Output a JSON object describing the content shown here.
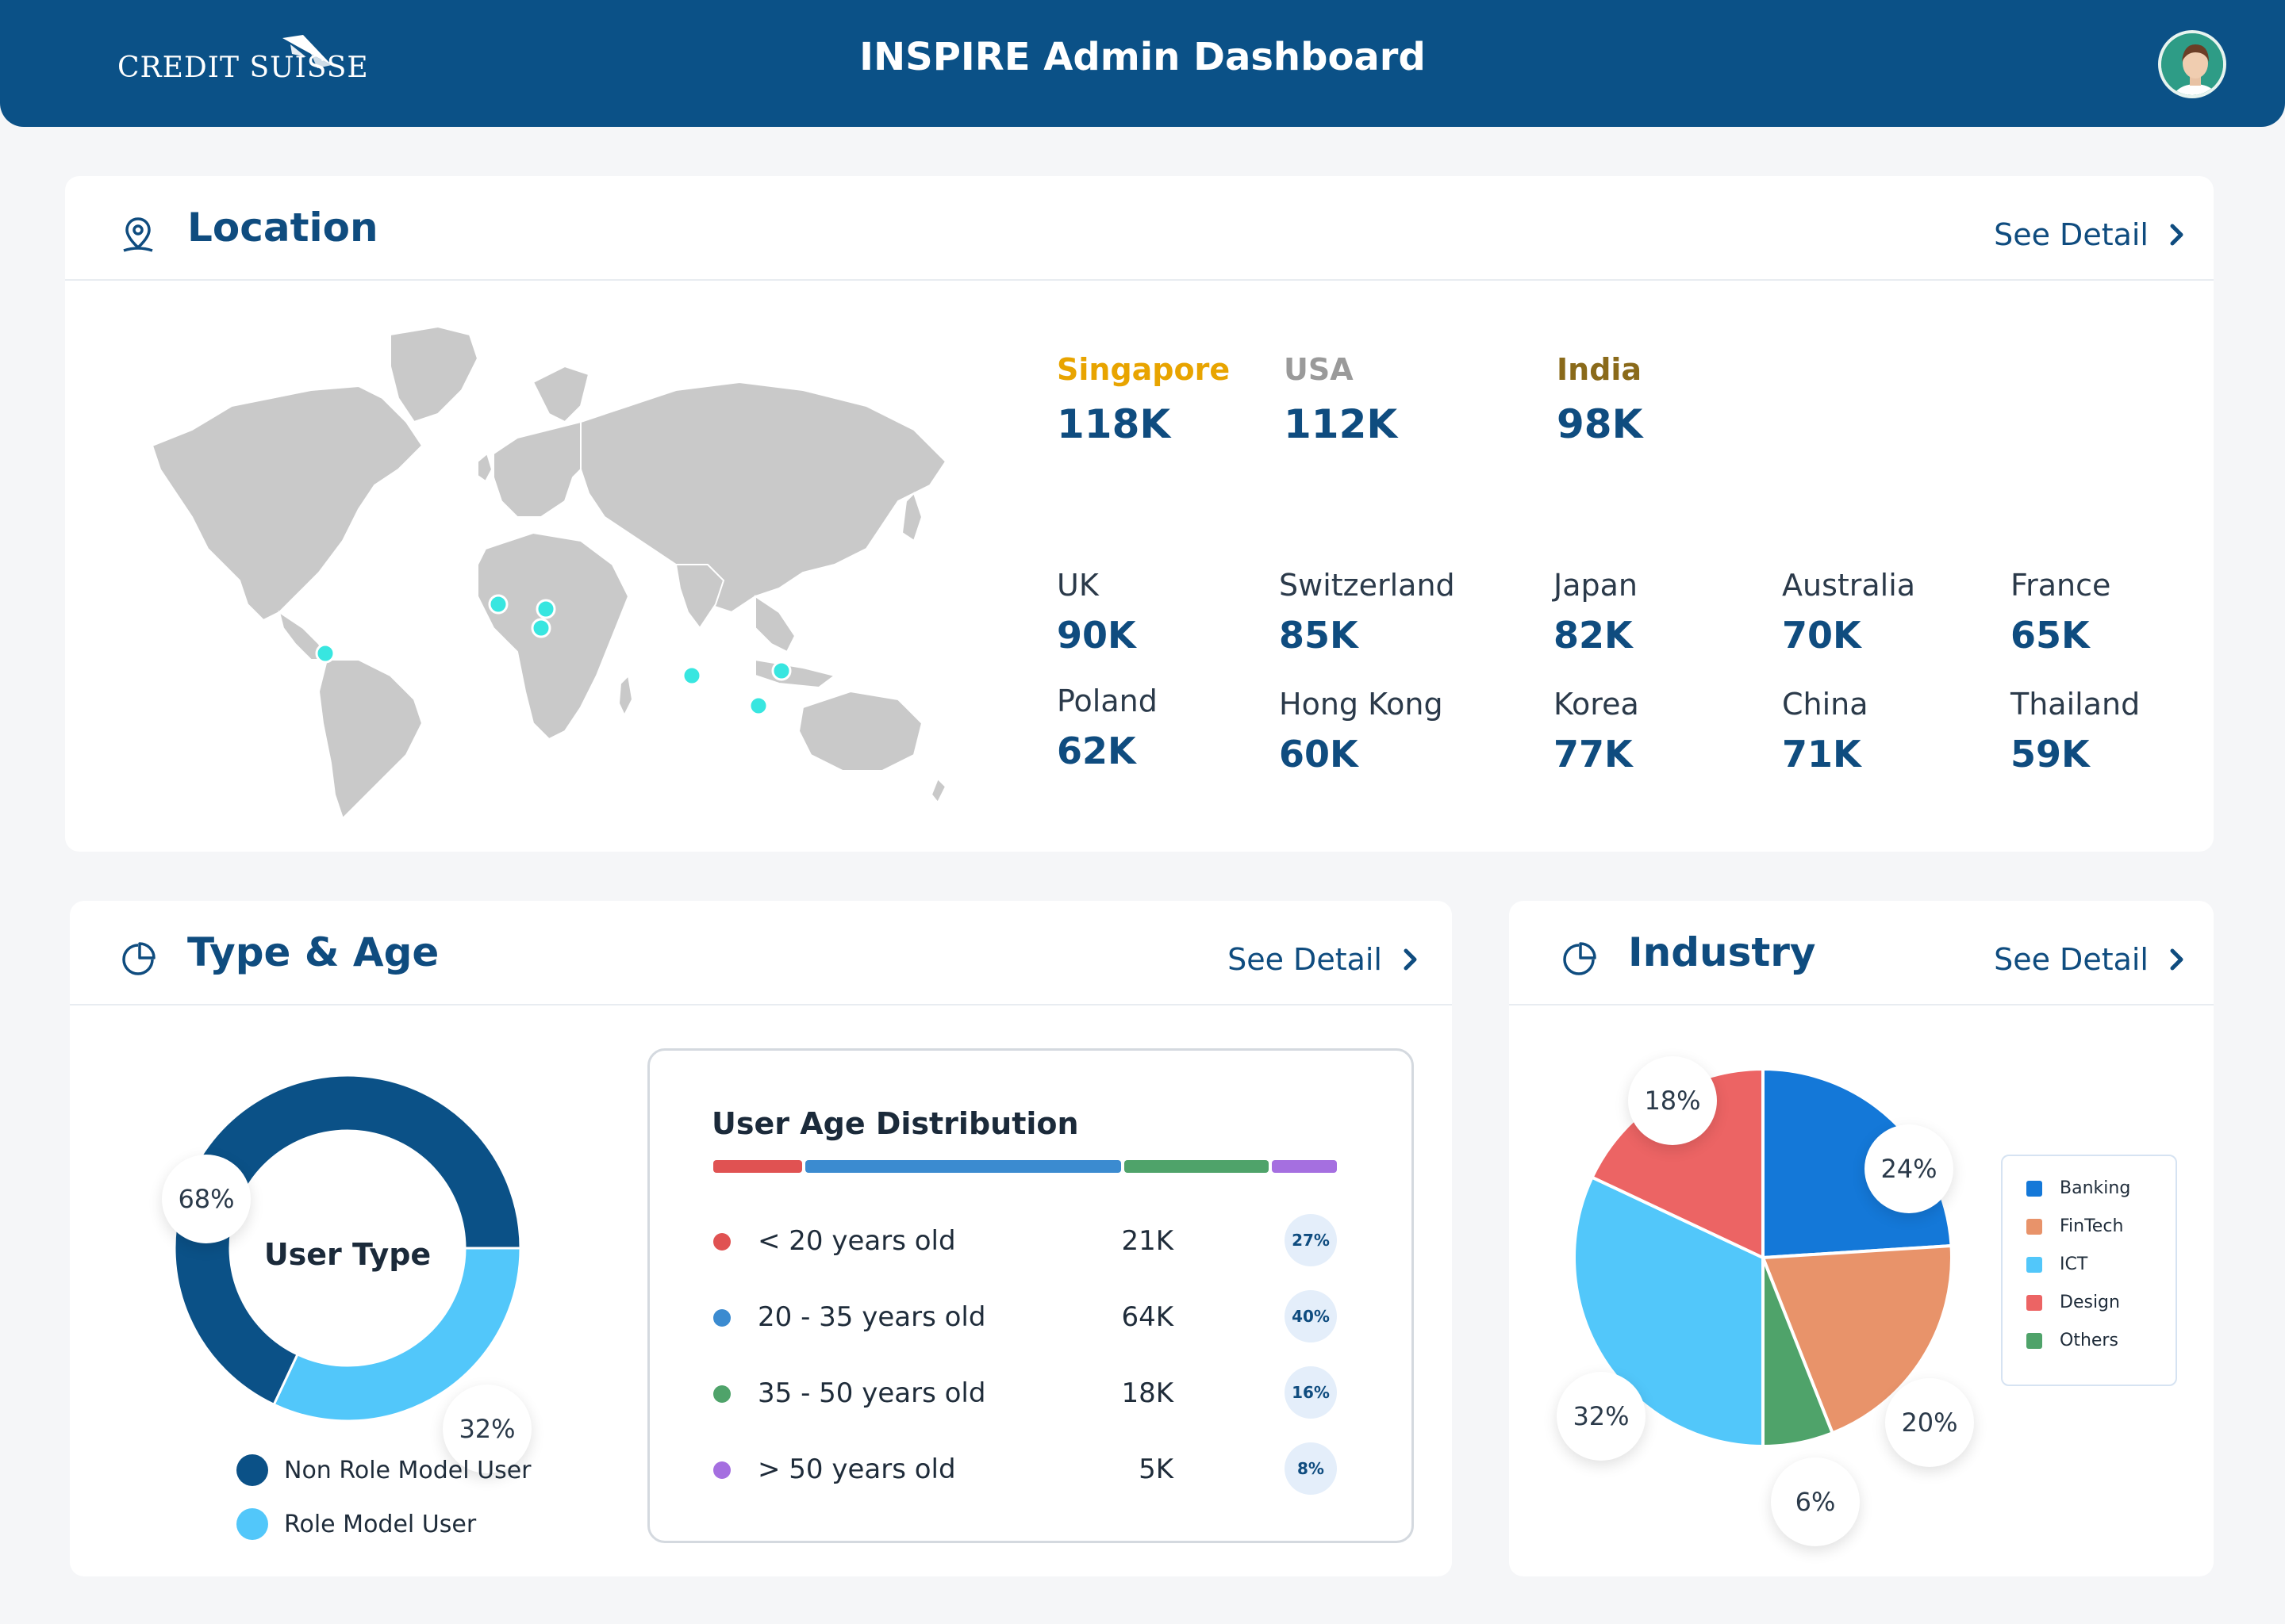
{
  "header": {
    "brand": "CREDIT SUISSE",
    "title": "INSPIRE Admin Dashboard"
  },
  "location": {
    "title": "Location",
    "see_detail": "See Detail",
    "top": [
      {
        "country": "Singapore",
        "value": "118K",
        "color": "#E8A400"
      },
      {
        "country": "USA",
        "value": "112K",
        "color": "#9A9A9A"
      },
      {
        "country": "India",
        "value": "98K",
        "color": "#8A6A1A"
      }
    ],
    "others": [
      {
        "country": "UK",
        "value": "90K"
      },
      {
        "country": "Switzerland",
        "value": "85K"
      },
      {
        "country": "Japan",
        "value": "82K"
      },
      {
        "country": "Australia",
        "value": "70K"
      },
      {
        "country": "France",
        "value": "65K"
      },
      {
        "country": "Poland",
        "value": "62K"
      },
      {
        "country": "Hong Kong",
        "value": "60K"
      },
      {
        "country": "Korea",
        "value": "77K"
      },
      {
        "country": "China",
        "value": "71K"
      },
      {
        "country": "Thailand",
        "value": "59K"
      }
    ]
  },
  "type_age": {
    "title": "Type & Age",
    "see_detail": "See Detail",
    "donut_center": "User Type",
    "segments": [
      {
        "label": "Non Role Model User",
        "percent": "68%",
        "value": 68,
        "color": "#0B5187"
      },
      {
        "label": "Role Model User",
        "percent": "32%",
        "value": 32,
        "color": "#52C7FA"
      }
    ],
    "age": {
      "title": "User Age Distribution",
      "rows": [
        {
          "label": "< 20 years old",
          "count": "21K",
          "percent": "27%",
          "color": "#E05252"
        },
        {
          "label": "20 - 35 years old",
          "count": "64K",
          "percent": "40%",
          "color": "#3B8BD0"
        },
        {
          "label": "35 - 50 years old",
          "count": "18K",
          "percent": "16%",
          "color": "#4FA36A"
        },
        {
          "label": "> 50 years old",
          "count": "5K",
          "percent": "8%",
          "color": "#A56FE0"
        }
      ]
    }
  },
  "industry": {
    "title": "Industry",
    "see_detail": "See Detail",
    "legend": [
      "Banking",
      "FinTech",
      "ICT",
      "Design",
      "Others"
    ]
  },
  "chart_data": [
    {
      "type": "pie",
      "title": "User Type",
      "categories": [
        "Non Role Model User",
        "Role Model User"
      ],
      "values": [
        68,
        32
      ],
      "colors": [
        "#0B5187",
        "#52C7FA"
      ]
    },
    {
      "type": "pie",
      "title": "",
      "categories": [
        "Banking",
        "FinTech",
        "Others",
        "ICT",
        "Design"
      ],
      "values": [
        24,
        20,
        6,
        32,
        18
      ],
      "colors": [
        "#1478D8",
        "#E8936A",
        "#4FA36A",
        "#52C7FA",
        "#EC6464"
      ]
    }
  ]
}
